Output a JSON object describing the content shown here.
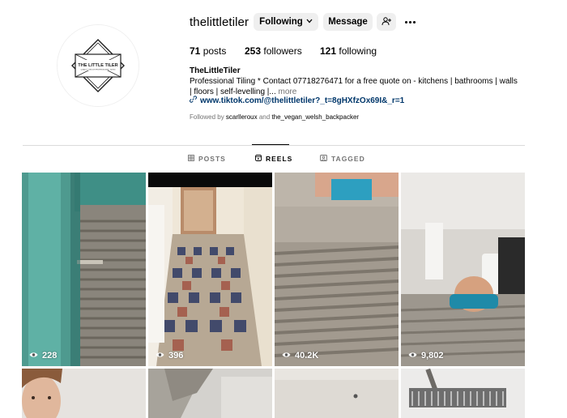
{
  "profile": {
    "username": "thelittletiler",
    "following_button": "Following",
    "message_button": "Message",
    "stats": {
      "posts_count": "71",
      "posts_label": "posts",
      "followers_count": "253",
      "followers_label": "followers",
      "following_count": "121",
      "following_label": "following"
    },
    "full_name": "TheLittleTiler",
    "bio": "Professional Tiling * Contact 07718276471 for a free quote on - kitchens | bathrooms | walls | floors | self-levelling |...",
    "bio_more": "more",
    "link": "www.tiktok.com/@thelittletiler?_t=8gHXfzOx69I&_r=1",
    "followed_by_prefix": "Followed by",
    "followed_by_user1": "scarlleroux",
    "followed_by_and": "and",
    "followed_by_user2": "the_vegan_welsh_backpacker",
    "logo": {
      "line1": "THE LITTLE TILER",
      "line2": "QUALITY WELSH PROFESSIONAL TILING"
    }
  },
  "tabs": [
    {
      "label": "POSTS",
      "icon": "grid-icon",
      "active": false
    },
    {
      "label": "REELS",
      "icon": "reels-icon",
      "active": true
    },
    {
      "label": "TAGGED",
      "icon": "tagged-icon",
      "active": false
    }
  ],
  "reels": [
    {
      "views": "228"
    },
    {
      "views": "396"
    },
    {
      "views": "40.2K"
    },
    {
      "views": "9,802"
    },
    {
      "views": ""
    },
    {
      "views": ""
    },
    {
      "views": ""
    },
    {
      "views": ""
    }
  ],
  "colors": {
    "button_bg": "#efefef",
    "link": "#00376b",
    "muted": "#737373"
  }
}
